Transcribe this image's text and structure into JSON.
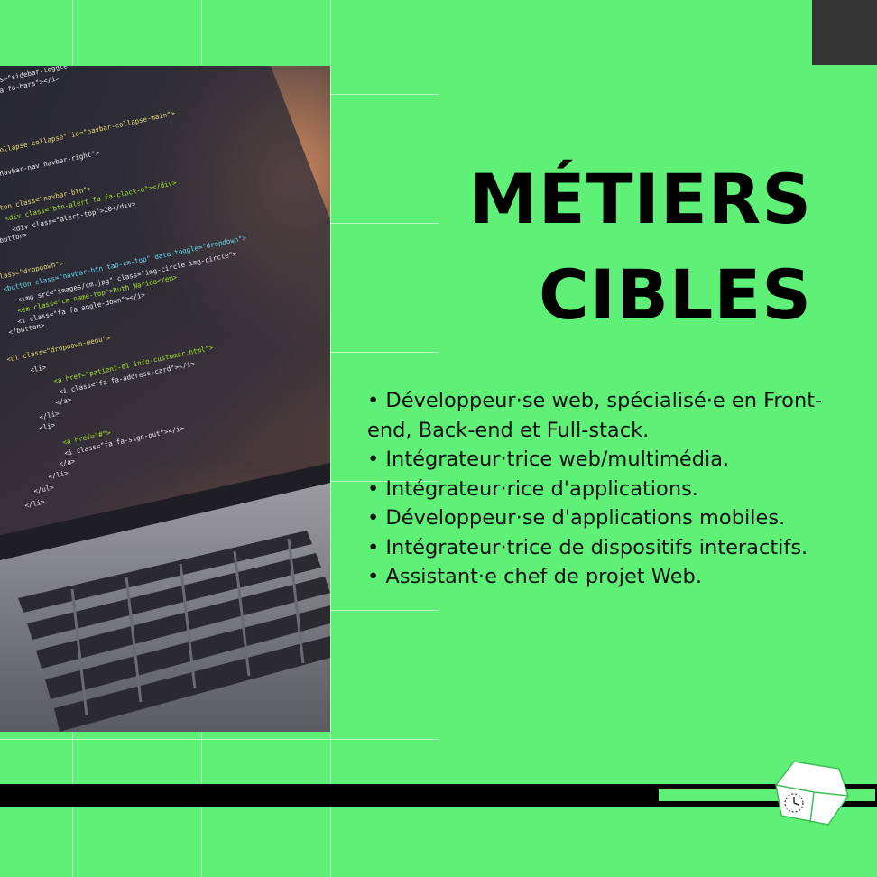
{
  "title": {
    "line1": "MÉTIERS",
    "line2": "CIBLES"
  },
  "jobs": [
    "• Développeur·se web, spécialisé·e en Front-end, Back-end et Full-stack.",
    "• Intégrateur·trice web/multimédia.",
    "• Intégrateur·rice d'applications.",
    "• Développeur·se d'applications mobiles.",
    "• Intégrateur·trice de dispositifs interactifs.",
    "• Assistant·e chef de projet Web."
  ],
  "photo": {
    "alt": "laptop-with-code-editor",
    "code_lines": [
      "s=\"sidebar-toggle\">",
      "a fa-bars\"></i>",
      "ollapse collapse\" id=\"navbar-collapse-main\">",
      "navbar-nav navbar-right\">",
      "ton class=\"navbar-btn\">",
      "<div class=\"btn-alert fa fa-clock-o\"></div>",
      "<div class=\"alert-top\">20</div>",
      "button>",
      "lass=\"dropdown\">",
      "<button class=\"navbar-btn tab-cm-top\" data-toggle=\"dropdown\">",
      "<img src=\"images/cm.jpg\" class=\"img-circle img-circle\">",
      "<em class=\"cm-name-top\">Ruth Warida</em>",
      "<i class=\"fa fa-angle-down\"></i>",
      "</button>",
      "<ul class=\"dropdown-menu\">",
      "<li>",
      "<a href=\"patient-01-info-customer.html\">",
      "<i class=\"fa fa-address-card\"></i>",
      "</a>",
      "</li>",
      "<li>",
      "<a href=\"#\">",
      "<i class=\"fa fa-sign-out\"></i>",
      "</a>",
      "</li>",
      "</ul>",
      "</li>"
    ]
  },
  "colors": {
    "background": "#5ef077",
    "text": "#000000",
    "corner_block": "#333333",
    "bottom_bar": "#000000"
  },
  "logo": {
    "icon": "white-cube-clock-logo"
  }
}
